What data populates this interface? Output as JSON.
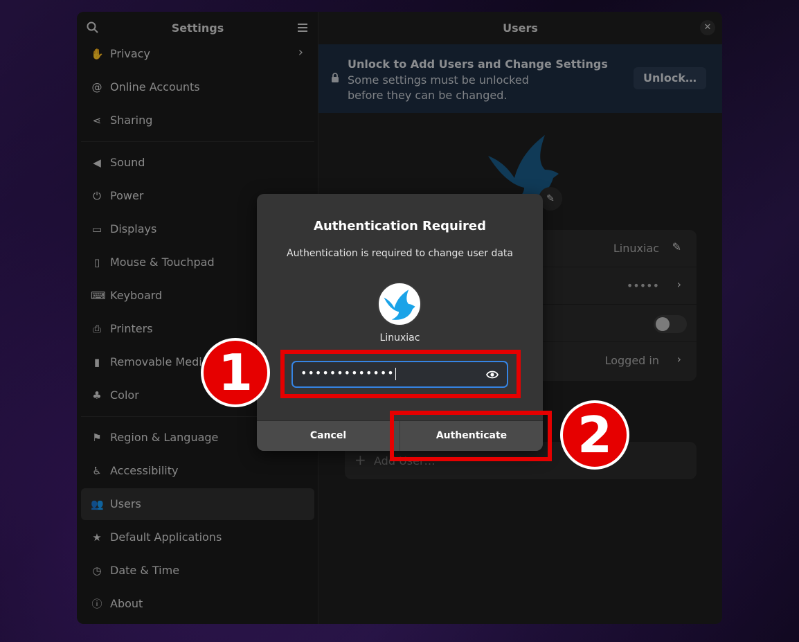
{
  "sidebar": {
    "title": "Settings",
    "items": [
      {
        "label": "Privacy",
        "icon": "hand-icon",
        "chevron": "›"
      },
      {
        "label": "Online Accounts",
        "icon": "at-icon"
      },
      {
        "label": "Sharing",
        "icon": "share-icon"
      },
      {
        "label": "Sound",
        "icon": "speaker-icon"
      },
      {
        "label": "Power",
        "icon": "power-icon"
      },
      {
        "label": "Displays",
        "icon": "display-icon"
      },
      {
        "label": "Mouse & Touchpad",
        "icon": "mouse-icon"
      },
      {
        "label": "Keyboard",
        "icon": "keyboard-icon"
      },
      {
        "label": "Printers",
        "icon": "printer-icon"
      },
      {
        "label": "Removable Media",
        "icon": "usb-icon"
      },
      {
        "label": "Color",
        "icon": "color-icon"
      },
      {
        "label": "Region & Language",
        "icon": "flag-icon"
      },
      {
        "label": "Accessibility",
        "icon": "accessibility-icon"
      },
      {
        "label": "Users",
        "icon": "users-icon"
      },
      {
        "label": "Default Applications",
        "icon": "star-icon"
      },
      {
        "label": "Date & Time",
        "icon": "clock-icon"
      },
      {
        "label": "About",
        "icon": "info-icon"
      }
    ]
  },
  "content": {
    "title": "Users",
    "banner": {
      "title": "Unlock to Add Users and Change Settings",
      "text": "Some settings must be unlocked before they can be changed.",
      "button": "Unlock…"
    },
    "rows": {
      "name": "Linuxiac",
      "password": "•••••",
      "last_login": "Logged in"
    },
    "add_user": "Add User…"
  },
  "dialog": {
    "title": "Authentication Required",
    "description": "Authentication is required to change user data",
    "user": "Linuxiac",
    "password_value": "•••••••••••••",
    "cancel": "Cancel",
    "authenticate": "Authenticate"
  },
  "annotations": {
    "step1": "1",
    "step2": "2",
    "color": "#e60000"
  },
  "colors": {
    "accent": "#3584e4",
    "bird": "#1aa3e8"
  }
}
